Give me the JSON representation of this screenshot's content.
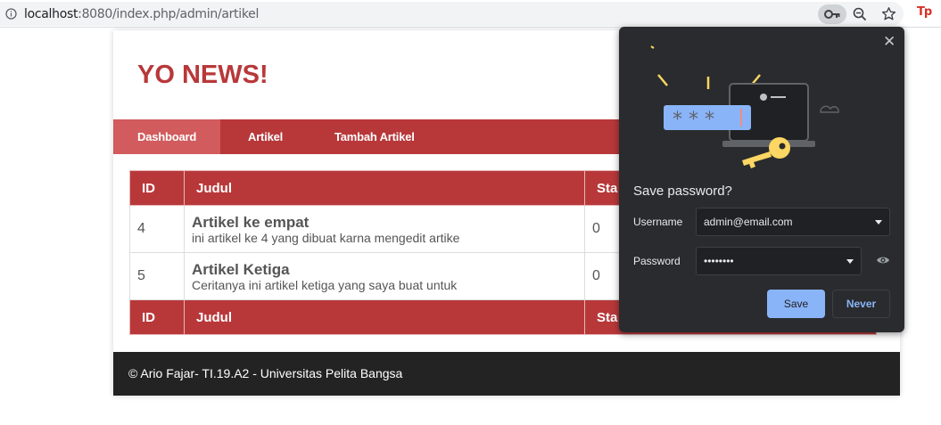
{
  "browser": {
    "url_host": "localhost",
    "url_path": ":8080/index.php/admin/artikel"
  },
  "site": {
    "title": "YO NEWS!",
    "nav": [
      "Dashboard",
      "Artikel",
      "Tambah Artikel"
    ],
    "active_nav": "Dashboard"
  },
  "table": {
    "headers": [
      "ID",
      "Judul",
      "Sta"
    ],
    "rows": [
      {
        "id": "4",
        "title": "Artikel ke empat",
        "desc": "ini artikel ke 4 yang dibuat karna mengedit artike",
        "status": "0"
      },
      {
        "id": "5",
        "title": "Artikel Ketiga",
        "desc": "Ceritanya ini artikel ketiga yang saya buat untuk",
        "status": "0"
      }
    ]
  },
  "footer": {
    "text": "© Ario Fajar- TI.19.A2 - Universitas Pelita Bangsa"
  },
  "password_popup": {
    "title": "Save password?",
    "username_label": "Username",
    "username_value": "admin@email.com",
    "password_label": "Password",
    "password_value": "••••••••",
    "save_label": "Save",
    "never_label": "Never",
    "close_glyph": "✕",
    "illustration_mask": "* * *"
  },
  "extension": {
    "badge": "Tp"
  },
  "colors": {
    "brand": "#b8383a",
    "brand_active": "#d15b5d",
    "footer": "#232323",
    "popup_bg": "#2a2b2e",
    "accent": "#8ab4f8"
  },
  "icons": [
    "info-icon",
    "key-icon",
    "zoom-out-icon",
    "star-icon",
    "close-icon",
    "eye-icon",
    "laptop-icon",
    "key-gold-icon"
  ]
}
